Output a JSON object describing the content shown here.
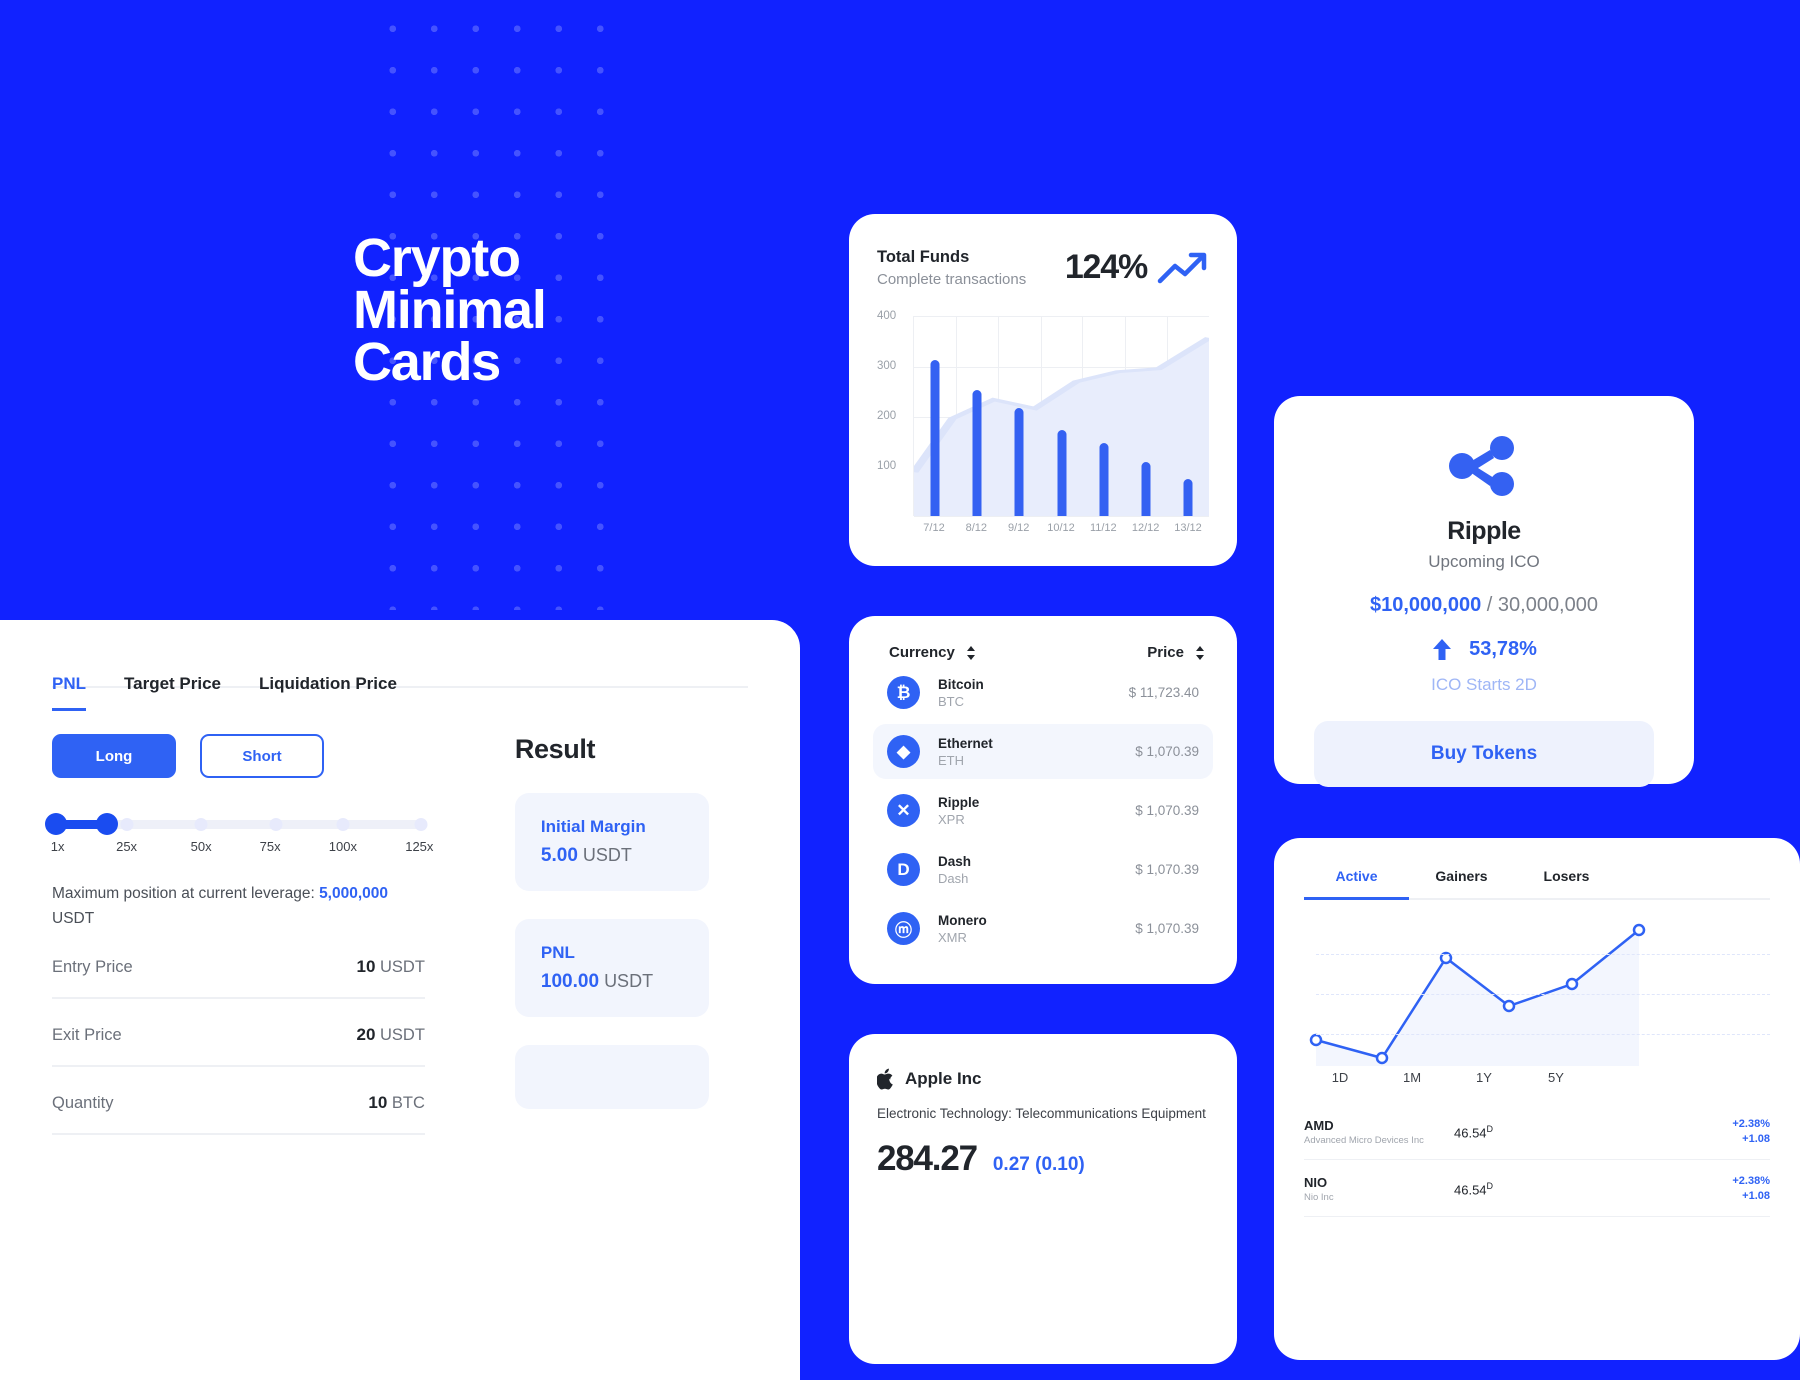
{
  "hero": {
    "title": "Crypto\nMinimal\nCards"
  },
  "pnl": {
    "tabs": [
      {
        "label": "PNL",
        "active": true
      },
      {
        "label": "Target Price",
        "active": false
      },
      {
        "label": "Liquidation Price",
        "active": false
      }
    ],
    "side_buttons": {
      "long": "Long",
      "short": "Short"
    },
    "leverage": {
      "ticks": [
        "1x",
        "25x",
        "50x",
        "75x",
        "100x",
        "125x"
      ],
      "value_pct": 14.7,
      "note_prefix": "Maximum position at current leverage: ",
      "note_value": "5,000,000",
      "note_suffix": " USDT"
    },
    "fields": [
      {
        "label": "Entry Price",
        "value": "10",
        "unit": "USDT"
      },
      {
        "label": "Exit Price",
        "value": "20",
        "unit": "USDT"
      },
      {
        "label": "Quantity",
        "value": "10",
        "unit": "BTC"
      }
    ],
    "result": {
      "title": "Result",
      "boxes": [
        {
          "label": "Initial Margin",
          "value": "5.00",
          "unit": "USDT"
        },
        {
          "label": "PNL",
          "value": "100.00",
          "unit": "USDT"
        }
      ]
    }
  },
  "funds": {
    "title": "Total Funds",
    "subtitle": "Complete transactions",
    "percent": "124%",
    "trend_icon": "trending-up-icon"
  },
  "currency_card": {
    "headers": {
      "currency": "Currency",
      "price": "Price"
    },
    "rows": [
      {
        "icon": "₿",
        "name": "Bitcoin",
        "symbol": "BTC",
        "price": "$ 11,723.40",
        "highlight": false
      },
      {
        "icon": "◆",
        "name": "Ethernet",
        "symbol": "ETH",
        "price": "$ 1,070.39",
        "highlight": true
      },
      {
        "icon": "✕",
        "name": "Ripple",
        "symbol": "XPR",
        "price": "$ 1,070.39",
        "highlight": false
      },
      {
        "icon": "D",
        "name": "Dash",
        "symbol": "Dash",
        "price": "$ 1,070.39",
        "highlight": false
      },
      {
        "icon": "ⓜ",
        "name": "Monero",
        "symbol": "XMR",
        "price": "$ 1,070.39",
        "highlight": false
      }
    ]
  },
  "apple": {
    "logo_icon": "apple-icon",
    "name": "Apple Inc",
    "description": "Electronic Technology: Telecommunications Equipment",
    "price": "284.27",
    "change": "0.27 (0.10)"
  },
  "ripple": {
    "logo_icon": "ripple-icon",
    "name": "Ripple",
    "subtitle": "Upcoming ICO",
    "raised": "$10,000,000",
    "goal": " / 30,000,000",
    "arrow_icon": "arrow-up-icon",
    "percent": "53,78%",
    "starts": "ICO Starts 2D",
    "cta": "Buy Tokens"
  },
  "stocks": {
    "tabs": [
      {
        "label": "Active",
        "active": true
      },
      {
        "label": "Gainers",
        "active": false
      },
      {
        "label": "Losers",
        "active": false
      }
    ],
    "ranges": [
      "1D",
      "1M",
      "1Y",
      "5Y"
    ],
    "rows": [
      {
        "symbol": "AMD",
        "company": "Advanced Micro Devices Inc",
        "value": "46.54",
        "sup": "D",
        "chg1": "+2.38%",
        "chg2": "+1.08"
      },
      {
        "symbol": "NIO",
        "company": "Nio Inc",
        "value": "46.54",
        "sup": "D",
        "chg1": "+2.38%",
        "chg2": "+1.08"
      }
    ]
  },
  "chart_data": [
    {
      "type": "bar",
      "title": "Total Funds",
      "subtitle": "Complete transactions",
      "categories": [
        "7/12",
        "8/12",
        "9/12",
        "10/12",
        "11/12",
        "12/12",
        "13/12"
      ],
      "values": [
        335,
        270,
        232,
        185,
        157,
        117,
        80
      ],
      "series": [
        {
          "name": "trend",
          "type": "area",
          "values": [
            95,
            212,
            252,
            232,
            290,
            312,
            318,
            385
          ]
        }
      ],
      "ylim": [
        0,
        430
      ],
      "yticks": [
        100,
        200,
        300,
        400
      ],
      "xlabel": "",
      "ylabel": "",
      "grid": true,
      "legend": "none"
    },
    {
      "type": "line",
      "title": "Active",
      "x": [
        "1D",
        "1M",
        "1Y",
        "5Y"
      ],
      "values": [
        38,
        18,
        88,
        52,
        70,
        96
      ],
      "grid": true,
      "legend": "none"
    }
  ]
}
